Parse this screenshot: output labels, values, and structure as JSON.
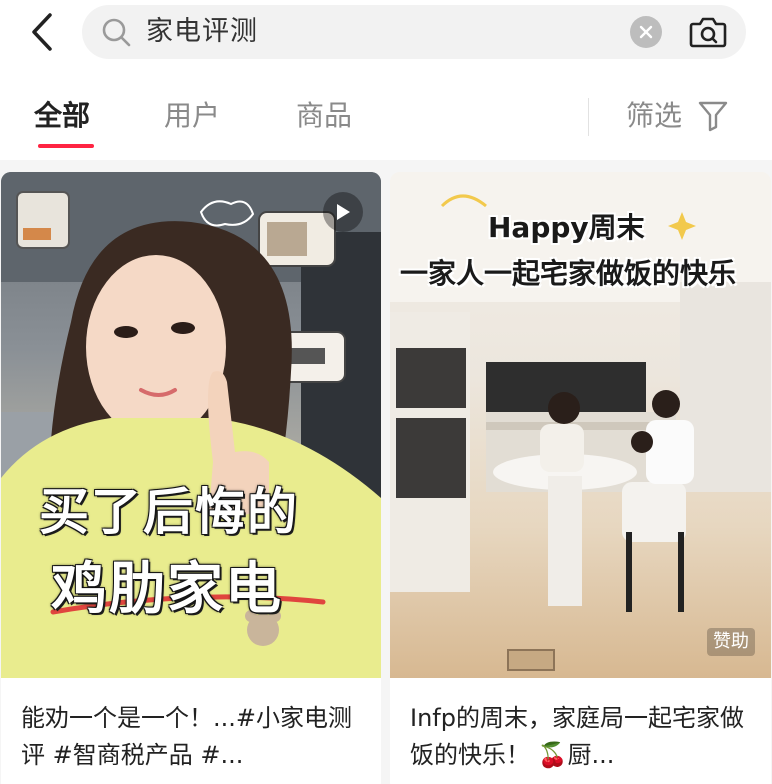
{
  "search": {
    "query": "家电评测"
  },
  "tabs": [
    {
      "label": "全部",
      "active": true
    },
    {
      "label": "用户",
      "active": false
    },
    {
      "label": "商品",
      "active": false
    }
  ],
  "filter": {
    "label": "筛选"
  },
  "notes": [
    {
      "cover_text_line1": "买了后悔的",
      "cover_text_line2": "鸡肋家电",
      "is_video": true,
      "title": "能劝一个是一个！...#小家电测评 #智商税产品 #..."
    },
    {
      "cover_text_line1": "Happy周末",
      "cover_text_line2": "一家人一起宅家做饭的快乐",
      "badge": "赞助",
      "title": "Infp的周末，家庭局一起宅家做饭的快乐！ 🍒厨..."
    }
  ],
  "colors": {
    "accent": "#ff2442",
    "inactive_text": "#8a8a8a",
    "search_bg": "#f2f2f2"
  },
  "icons": [
    "chevron-left-icon",
    "search-icon",
    "clear-icon",
    "camera-icon",
    "filter-icon",
    "play-icon"
  ]
}
